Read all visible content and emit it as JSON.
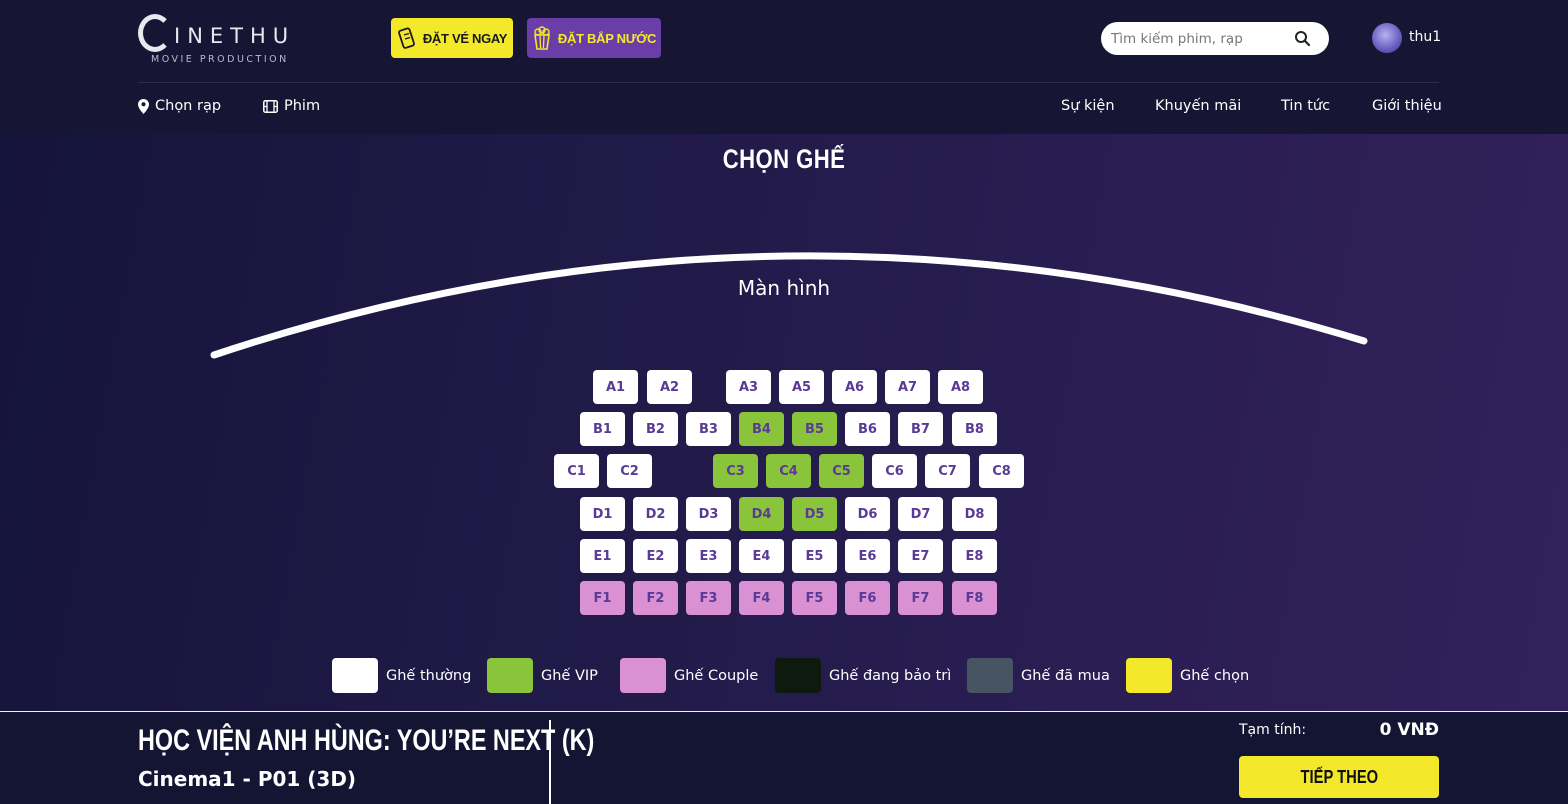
{
  "brand": {
    "name": "INETHU",
    "tagline": "MOVIE PRODUCTION"
  },
  "header": {
    "book_ticket_label": "ĐẶT VÉ NGAY",
    "book_popcorn_label": "ĐẶT BẮP NƯỚC",
    "search_placeholder": "Tìm kiếm phim, rạp",
    "username": "thu1"
  },
  "nav": {
    "left": [
      {
        "label": "Chọn rạp",
        "icon": "map-pin-icon"
      },
      {
        "label": "Phim",
        "icon": "film-icon"
      }
    ],
    "right": [
      "Sự kiện",
      "Khuyến mãi",
      "Tin tức",
      "Giới thiệu"
    ]
  },
  "page_title": "CHỌN GHẾ",
  "screen_label": "Màn hình",
  "seat_colors": {
    "normal": "#ffffff",
    "vip": "#8ac43b",
    "couple": "#d991d3",
    "maintenance": "#0f1a0e",
    "sold": "#475462",
    "selected": "#f3e92a",
    "label": "#5a3a96"
  },
  "seat_rows": [
    {
      "row": "A",
      "seats": [
        {
          "id": "A1",
          "type": "normal"
        },
        {
          "id": "A2",
          "type": "normal"
        },
        {
          "id": "A3",
          "type": "normal"
        },
        {
          "id": "A5",
          "type": "normal"
        },
        {
          "id": "A6",
          "type": "normal"
        },
        {
          "id": "A7",
          "type": "normal"
        },
        {
          "id": "A8",
          "type": "normal"
        }
      ]
    },
    {
      "row": "B",
      "seats": [
        {
          "id": "B1",
          "type": "normal"
        },
        {
          "id": "B2",
          "type": "normal"
        },
        {
          "id": "B3",
          "type": "normal"
        },
        {
          "id": "B4",
          "type": "vip"
        },
        {
          "id": "B5",
          "type": "vip"
        },
        {
          "id": "B6",
          "type": "normal"
        },
        {
          "id": "B7",
          "type": "normal"
        },
        {
          "id": "B8",
          "type": "normal"
        }
      ]
    },
    {
      "row": "C",
      "seats": [
        {
          "id": "C1",
          "type": "normal"
        },
        {
          "id": "C2",
          "type": "normal"
        },
        {
          "id": "C3",
          "type": "vip"
        },
        {
          "id": "C4",
          "type": "vip"
        },
        {
          "id": "C5",
          "type": "vip"
        },
        {
          "id": "C6",
          "type": "normal"
        },
        {
          "id": "C7",
          "type": "normal"
        },
        {
          "id": "C8",
          "type": "normal"
        }
      ]
    },
    {
      "row": "D",
      "seats": [
        {
          "id": "D1",
          "type": "normal"
        },
        {
          "id": "D2",
          "type": "normal"
        },
        {
          "id": "D3",
          "type": "normal"
        },
        {
          "id": "D4",
          "type": "vip"
        },
        {
          "id": "D5",
          "type": "vip"
        },
        {
          "id": "D6",
          "type": "normal"
        },
        {
          "id": "D7",
          "type": "normal"
        },
        {
          "id": "D8",
          "type": "normal"
        }
      ]
    },
    {
      "row": "E",
      "seats": [
        {
          "id": "E1",
          "type": "normal"
        },
        {
          "id": "E2",
          "type": "normal"
        },
        {
          "id": "E3",
          "type": "normal"
        },
        {
          "id": "E4",
          "type": "normal"
        },
        {
          "id": "E5",
          "type": "normal"
        },
        {
          "id": "E6",
          "type": "normal"
        },
        {
          "id": "E7",
          "type": "normal"
        },
        {
          "id": "E8",
          "type": "normal"
        }
      ]
    },
    {
      "row": "F",
      "seats": [
        {
          "id": "F1",
          "type": "couple"
        },
        {
          "id": "F2",
          "type": "couple"
        },
        {
          "id": "F3",
          "type": "couple"
        },
        {
          "id": "F4",
          "type": "couple"
        },
        {
          "id": "F5",
          "type": "couple"
        },
        {
          "id": "F6",
          "type": "couple"
        },
        {
          "id": "F7",
          "type": "couple"
        },
        {
          "id": "F8",
          "type": "couple"
        }
      ]
    }
  ],
  "legend": [
    {
      "label": "Ghế thường",
      "color": "#ffffff"
    },
    {
      "label": "Ghế VIP",
      "color": "#8ac43b"
    },
    {
      "label": "Ghế Couple",
      "color": "#d991d3"
    },
    {
      "label": "Ghế đang bảo trì",
      "color": "#0f1a0e"
    },
    {
      "label": "Ghế đã mua",
      "color": "#475462"
    },
    {
      "label": "Ghế chọn",
      "color": "#f3e92a"
    }
  ],
  "footer": {
    "movie_title": "HỌC VIỆN ANH HÙNG: YOU’RE NEXT (K)",
    "room": "Cinema1 - P01 (3D)",
    "subtotal_label": "Tạm tính:",
    "subtotal_value": "0 VNĐ",
    "next_label": "TIẾP THEO"
  }
}
